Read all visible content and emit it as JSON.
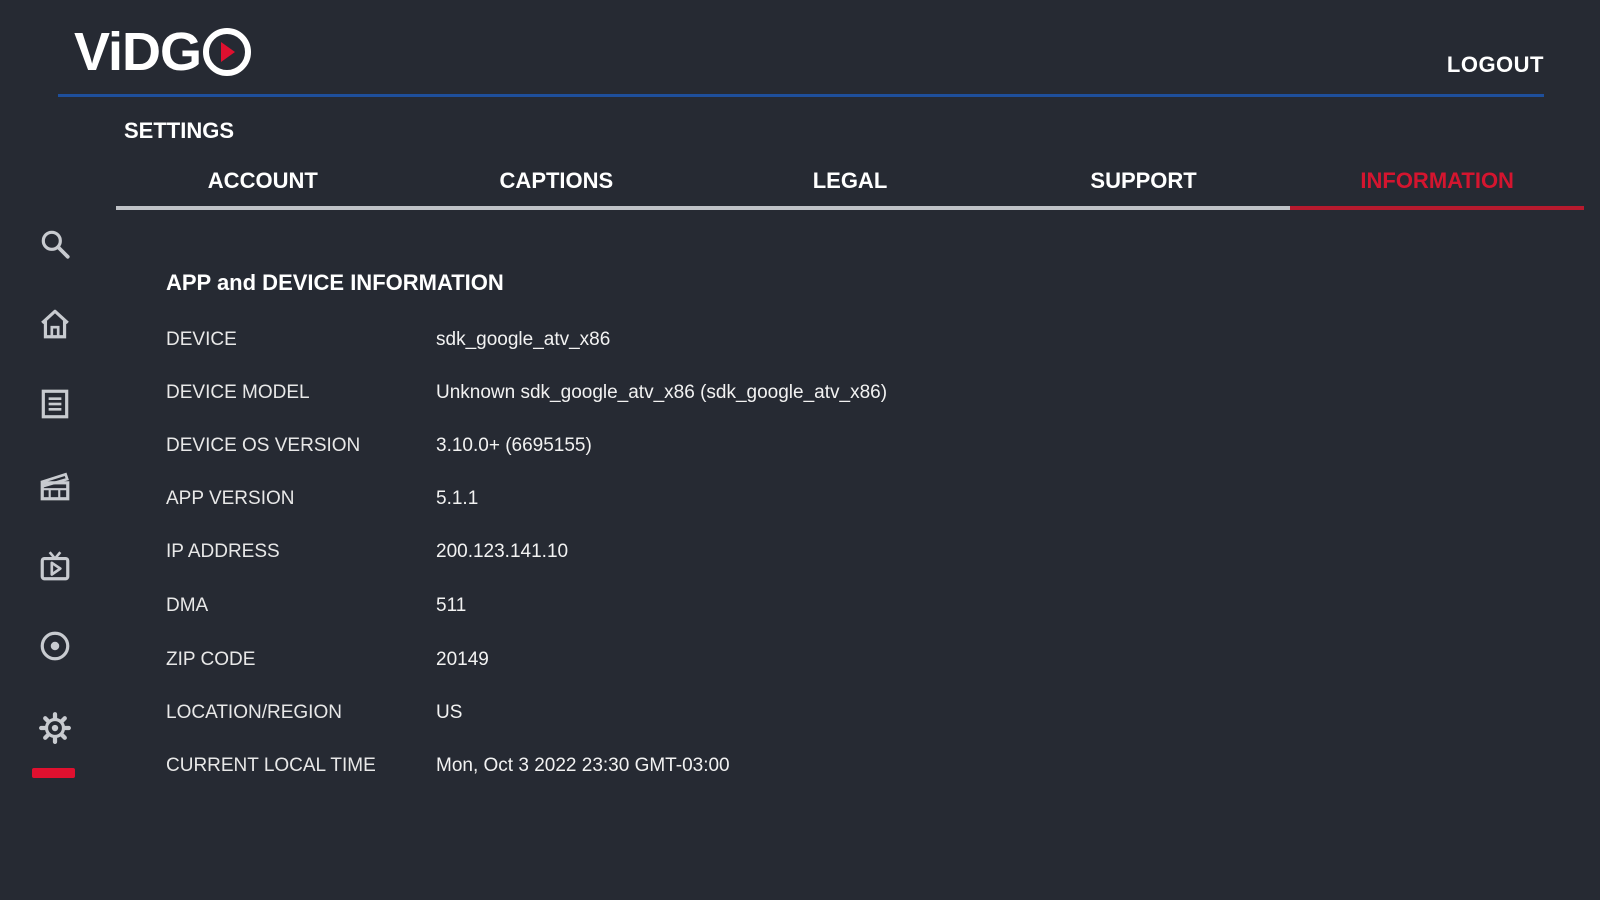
{
  "header": {
    "logo_text": "ViDGO",
    "logout_label": "LOGOUT"
  },
  "settings": {
    "title": "SETTINGS",
    "tabs": [
      {
        "label": "ACCOUNT"
      },
      {
        "label": "CAPTIONS"
      },
      {
        "label": "LEGAL"
      },
      {
        "label": "SUPPORT"
      },
      {
        "label": "INFORMATION",
        "active": true
      }
    ]
  },
  "sidebar": {
    "items": [
      {
        "icon": "search-icon"
      },
      {
        "icon": "home-icon"
      },
      {
        "icon": "guide-icon"
      },
      {
        "icon": "movies-icon"
      },
      {
        "icon": "tv-shows-icon"
      },
      {
        "icon": "dvr-icon"
      },
      {
        "icon": "settings-gear-icon",
        "active": true
      }
    ]
  },
  "info": {
    "title": "APP and DEVICE INFORMATION",
    "rows": [
      {
        "label": "DEVICE",
        "value": "sdk_google_atv_x86"
      },
      {
        "label": "DEVICE MODEL",
        "value": "Unknown sdk_google_atv_x86 (sdk_google_atv_x86)"
      },
      {
        "label": "DEVICE OS VERSION",
        "value": "3.10.0+ (6695155)"
      },
      {
        "label": "APP VERSION",
        "value": "5.1.1"
      },
      {
        "label": "IP ADDRESS",
        "value": "200.123.141.10"
      },
      {
        "label": "DMA",
        "value": "511"
      },
      {
        "label": "ZIP CODE",
        "value": "20149"
      },
      {
        "label": "LOCATION/REGION",
        "value": "US"
      },
      {
        "label": "CURRENT LOCAL TIME",
        "value": "Mon, Oct 3 2022 23:30 GMT-03:00"
      }
    ]
  },
  "colors": {
    "background": "#262a33",
    "accent_red": "#e0102f",
    "header_rule_blue": "#1e4f9c"
  }
}
